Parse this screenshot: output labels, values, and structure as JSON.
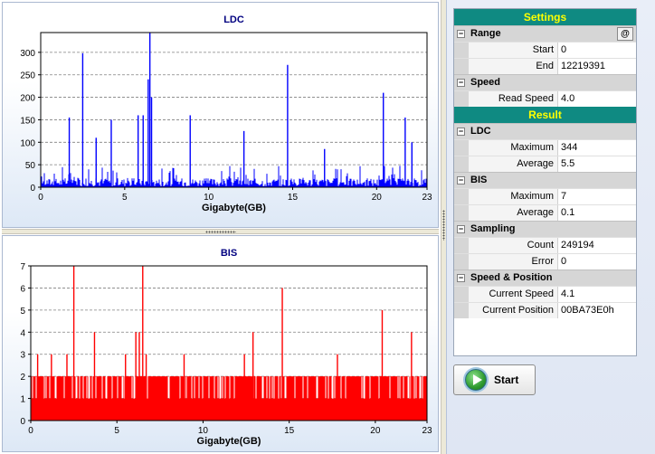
{
  "charts": {
    "ldc": {
      "title": "LDC",
      "xlabel": "Gigabyte(GB)",
      "color": "#0000ff",
      "y_ticks": [
        "0",
        "50",
        "100",
        "150",
        "200",
        "250",
        "300"
      ],
      "x_ticks": [
        "0",
        "5",
        "10",
        "15",
        "20",
        "23"
      ]
    },
    "bis": {
      "title": "BIS",
      "xlabel": "Gigabyte(GB)",
      "color": "#ff0000",
      "y_ticks": [
        "0",
        "1",
        "2",
        "3",
        "4",
        "5",
        "6",
        "7"
      ],
      "x_ticks": [
        "0",
        "5",
        "10",
        "15",
        "20",
        "23"
      ]
    }
  },
  "chart_data": [
    {
      "type": "bar",
      "title": "LDC",
      "xlabel": "Gigabyte(GB)",
      "ylabel": "",
      "xlim": [
        0,
        23
      ],
      "ylim": [
        0,
        344
      ],
      "grid": true,
      "baseline_range": [
        2,
        20
      ],
      "spikes": [
        {
          "x": 1.7,
          "y": 155
        },
        {
          "x": 2.5,
          "y": 298
        },
        {
          "x": 3.3,
          "y": 110
        },
        {
          "x": 4.2,
          "y": 150
        },
        {
          "x": 5.8,
          "y": 160
        },
        {
          "x": 6.1,
          "y": 160
        },
        {
          "x": 6.4,
          "y": 240
        },
        {
          "x": 6.5,
          "y": 344
        },
        {
          "x": 6.6,
          "y": 200
        },
        {
          "x": 8.9,
          "y": 160
        },
        {
          "x": 12.1,
          "y": 125
        },
        {
          "x": 14.7,
          "y": 272
        },
        {
          "x": 16.9,
          "y": 85
        },
        {
          "x": 20.4,
          "y": 210
        },
        {
          "x": 21.7,
          "y": 155
        },
        {
          "x": 22.1,
          "y": 100
        }
      ]
    },
    {
      "type": "bar",
      "title": "BIS",
      "xlabel": "Gigabyte(GB)",
      "ylabel": "",
      "xlim": [
        0,
        23
      ],
      "ylim": [
        0,
        7
      ],
      "grid": true,
      "baseline_range": [
        1,
        2
      ],
      "spikes": [
        {
          "x": 0.4,
          "y": 3
        },
        {
          "x": 1.2,
          "y": 3
        },
        {
          "x": 2.1,
          "y": 3
        },
        {
          "x": 2.5,
          "y": 7
        },
        {
          "x": 3.7,
          "y": 4
        },
        {
          "x": 5.5,
          "y": 3
        },
        {
          "x": 6.1,
          "y": 4
        },
        {
          "x": 6.3,
          "y": 4
        },
        {
          "x": 6.5,
          "y": 7
        },
        {
          "x": 6.7,
          "y": 3
        },
        {
          "x": 8.9,
          "y": 3
        },
        {
          "x": 12.4,
          "y": 3
        },
        {
          "x": 12.9,
          "y": 4
        },
        {
          "x": 14.6,
          "y": 6
        },
        {
          "x": 17.8,
          "y": 3
        },
        {
          "x": 20.4,
          "y": 5
        },
        {
          "x": 22.1,
          "y": 4
        }
      ]
    }
  ],
  "settings": {
    "header": "Settings",
    "range": {
      "label": "Range",
      "button": "@",
      "start_label": "Start",
      "start_value": "0",
      "end_label": "End",
      "end_value": "12219391"
    },
    "speed": {
      "label": "Speed",
      "read_speed_label": "Read Speed",
      "read_speed_value": "4.0"
    }
  },
  "result": {
    "header": "Result",
    "ldc": {
      "label": "LDC",
      "max_label": "Maximum",
      "max_value": "344",
      "avg_label": "Average",
      "avg_value": "5.5"
    },
    "bis": {
      "label": "BIS",
      "max_label": "Maximum",
      "max_value": "7",
      "avg_label": "Average",
      "avg_value": "0.1"
    },
    "sampling": {
      "label": "Sampling",
      "count_label": "Count",
      "count_value": "249194",
      "error_label": "Error",
      "error_value": "0"
    },
    "speed_position": {
      "label": "Speed & Position",
      "current_speed_label": "Current Speed",
      "current_speed_value": "4.1",
      "current_position_label": "Current Position",
      "current_position_value": "00BA73E0h"
    }
  },
  "start_button": "Start"
}
